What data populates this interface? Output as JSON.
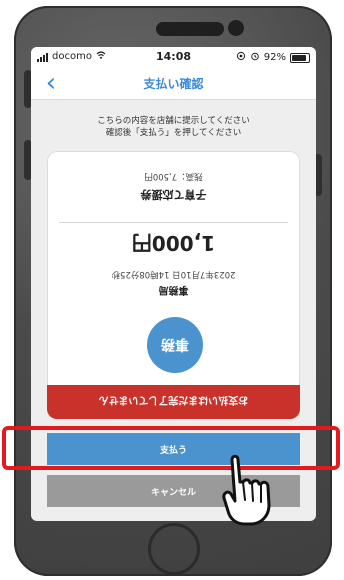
{
  "status_bar": {
    "carrier": "docomo",
    "time": "14:08",
    "battery": "92%"
  },
  "nav": {
    "back_icon": "chevron-left-icon",
    "title": "支払い確認"
  },
  "instructions": {
    "line1": "こちらの内容を店舗に提示してください",
    "line2": "確認後「支払う」を押してください"
  },
  "card": {
    "warning_text": "お支払いはまだ完了していません",
    "stamp_label": "事務",
    "store_name": "事務局",
    "timestamp": "2023年7月10日 14時08分25秒",
    "amount": "1,000円",
    "ticket_name": "子育て応援券",
    "balance": "残高：7,500円"
  },
  "buttons": {
    "pay": "支払う",
    "cancel": "キャンセル"
  },
  "colors": {
    "accent": "#4a93cf",
    "warning": "#c9322b",
    "highlight": "#e3191b",
    "phone_body": "#4b4b4b"
  }
}
